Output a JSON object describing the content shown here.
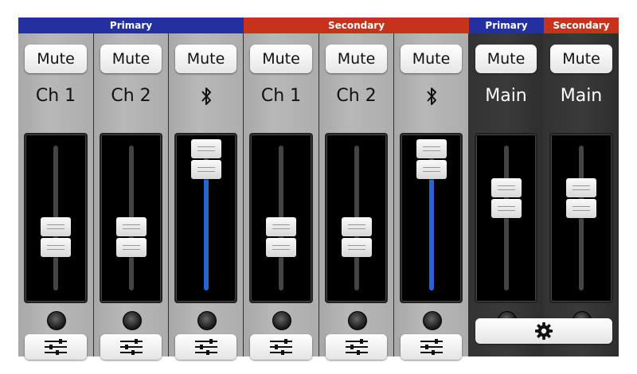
{
  "groups": [
    {
      "label": "Primary",
      "color": "#2430a0"
    },
    {
      "label": "Secondary",
      "color": "#c6331c"
    },
    {
      "label": "Primary",
      "color": "#2430a0"
    },
    {
      "label": "Secondary",
      "color": "#c6331c"
    }
  ],
  "mute_label": "Mute",
  "strips": [
    {
      "label": "Ch 1",
      "icon": "",
      "fader_level": 0.34
    },
    {
      "label": "Ch 2",
      "icon": "",
      "fader_level": 0.34
    },
    {
      "label": "",
      "icon": "bluetooth-icon",
      "fader_level": 1.0
    },
    {
      "label": "Ch 1",
      "icon": "",
      "fader_level": 0.34
    },
    {
      "label": "Ch 2",
      "icon": "",
      "fader_level": 0.34
    },
    {
      "label": "",
      "icon": "bluetooth-icon",
      "fader_level": 1.0
    },
    {
      "label": "Main",
      "icon": "",
      "fader_level": 0.67
    },
    {
      "label": "Main",
      "icon": "",
      "fader_level": 0.67
    }
  ],
  "bottom_buttons": [
    "eq-sliders-icon",
    "gear-icon"
  ],
  "colors": {
    "fader_fill": "#2a62d4",
    "strip_light": "#b0b0b0",
    "strip_dark": "#333333"
  }
}
